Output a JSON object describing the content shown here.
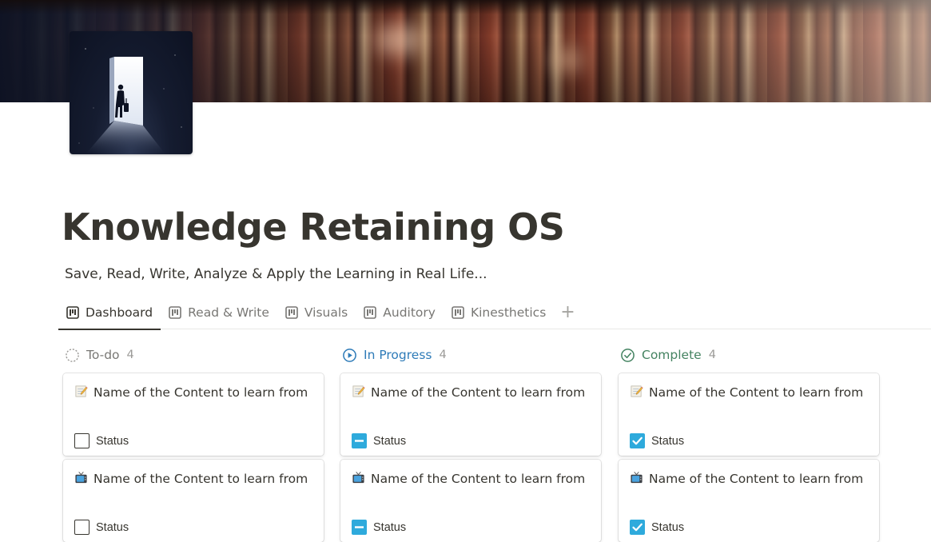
{
  "page": {
    "title": "Knowledge Retaining OS",
    "subtitle": "Save, Read, Write, Analyze & Apply the Learning in Real Life...",
    "icon": "person-walking-into-doorway-icon",
    "cover": "bookshelf-cover-image"
  },
  "tabs": [
    {
      "label": "Dashboard",
      "icon": "board-view-icon",
      "active": true
    },
    {
      "label": "Read & Write",
      "icon": "board-view-icon",
      "active": false
    },
    {
      "label": "Visuals",
      "icon": "board-view-icon",
      "active": false
    },
    {
      "label": "Auditory",
      "icon": "board-view-icon",
      "active": false
    },
    {
      "label": "Kinesthetics",
      "icon": "board-view-icon",
      "active": false
    }
  ],
  "add_tab_label": "+",
  "columns": [
    {
      "name": "To-do",
      "count": "4",
      "icon": "dashed-circle-icon",
      "color": "#787774",
      "cards": [
        {
          "emoji": "memo-icon",
          "title": "Name of the Content to learn from",
          "status_label": "Status",
          "checkbox": "empty"
        },
        {
          "emoji": "television-icon",
          "title": "Name of the Content to learn from",
          "status_label": "Status",
          "checkbox": "empty"
        }
      ]
    },
    {
      "name": "In Progress",
      "count": "4",
      "icon": "play-circle-icon",
      "color": "#2e7bb8",
      "cards": [
        {
          "emoji": "memo-icon",
          "title": "Name of the Content to learn from",
          "status_label": "Status",
          "checkbox": "indeterminate"
        },
        {
          "emoji": "television-icon",
          "title": "Name of the Content to learn from",
          "status_label": "Status",
          "checkbox": "indeterminate"
        }
      ]
    },
    {
      "name": "Complete",
      "count": "4",
      "icon": "check-circle-icon",
      "color": "#448361",
      "cards": [
        {
          "emoji": "memo-icon",
          "title": "Name of the Content to learn from",
          "status_label": "Status",
          "checkbox": "checked"
        },
        {
          "emoji": "television-icon",
          "title": "Name of the Content to learn from",
          "status_label": "Status",
          "checkbox": "checked"
        }
      ]
    }
  ],
  "colors": {
    "text": "#37352f",
    "muted": "#787774",
    "checkbox_blue": "#2eaadc",
    "in_progress": "#2e7bb8",
    "complete": "#448361"
  }
}
